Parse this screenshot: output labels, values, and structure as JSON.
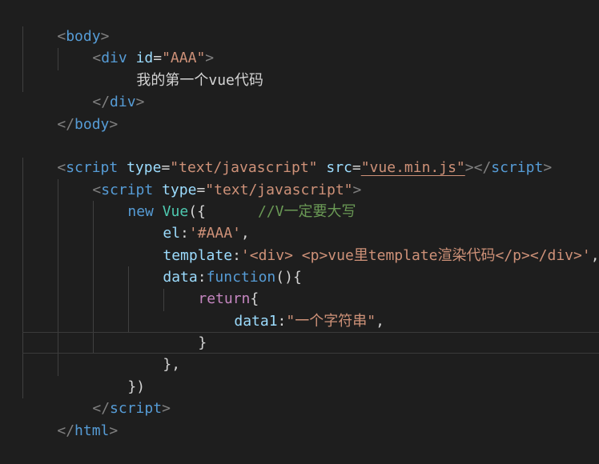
{
  "colors": {
    "background": "#1e1e1e",
    "tag": "#569cd6",
    "attribute": "#9cdcfe",
    "string": "#ce9178",
    "control_keyword": "#c586c0",
    "class_name": "#4ec9b0",
    "comment": "#6a9955",
    "bracket": "#808080",
    "text": "#d4d4d4"
  },
  "code": {
    "l1": [
      "<",
      "body",
      ">"
    ],
    "l2": [
      "<",
      "div",
      " ",
      "id",
      "=",
      "\"AAA\"",
      ">"
    ],
    "l3": [
      "我的第一个vue代码"
    ],
    "l4": [
      "</",
      "div",
      ">"
    ],
    "l5": [
      "</",
      "body",
      ">"
    ],
    "l7": [
      "<",
      "script",
      " ",
      "type",
      "=",
      "\"text/javascript\"",
      " ",
      "src",
      "=",
      "\"vue.min.js\"",
      "></",
      "script",
      ">"
    ],
    "l8": [
      "<",
      "script",
      " ",
      "type",
      "=",
      "\"text/javascript\"",
      ">"
    ],
    "l9": [
      "new",
      " ",
      "Vue",
      "({",
      "      ",
      "//V一定要大写"
    ],
    "l10": [
      "el",
      ":",
      "'#AAA'",
      ","
    ],
    "l11": [
      "template",
      ":",
      "'<div> <p>vue里template渲染代码</p></div>'",
      ","
    ],
    "l12": [
      "data",
      ":",
      "function",
      "(){"
    ],
    "l13": [
      "return",
      "{"
    ],
    "l14": [
      "data1",
      ":",
      "\"一个字符串\"",
      ","
    ],
    "l15": [
      "}"
    ],
    "l16": [
      "},"
    ],
    "l17": [
      "})"
    ],
    "l18": [
      "</",
      "script",
      ">"
    ],
    "l19": [
      "</",
      "html",
      ">"
    ]
  }
}
